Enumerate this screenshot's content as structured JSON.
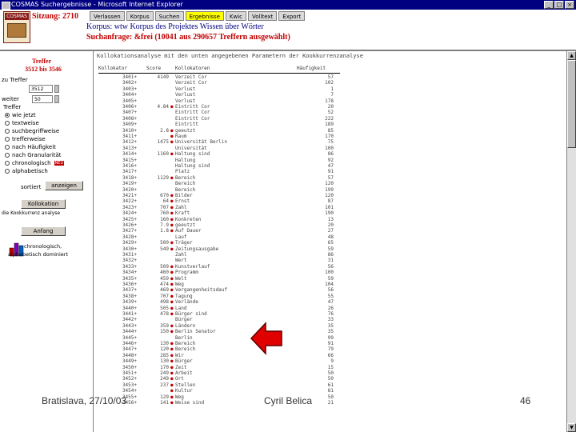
{
  "window": {
    "title": "COSMAS Suchergebnisse - Microsoft Internet Explorer"
  },
  "header": {
    "session": "Sitzung: 2710",
    "tabs": [
      "Verlassen",
      "Korpus",
      "Suchen",
      "Ergebnisse",
      "Kwic",
      "Volltext",
      "Export"
    ],
    "active_tab": "Ergebnisse",
    "korpus_line": "Korpus: wtw Korpus des Projektes Wissen über Wörter",
    "anfrage_line": "Suchanfrage: &frei (10041 aus 290657 Treffern ausgewählt)"
  },
  "sidebar": {
    "title": "Treffer",
    "range": "3512 bis 3546",
    "zu_treffer_label": "zu Treffer",
    "zu_treffer_value": "3512",
    "weiter_label": "weiter",
    "weiter_value": "50",
    "sort_label": "Treffer",
    "sort_options": [
      {
        "label": "wie jetzt",
        "checked": true
      },
      {
        "label": "textweise",
        "checked": false
      },
      {
        "label": "suchbegriffweise",
        "checked": false
      },
      {
        "label": "trefferweise",
        "checked": false
      },
      {
        "label": "nach Häufigkeit",
        "checked": false
      },
      {
        "label": "nach Granularität",
        "checked": false
      },
      {
        "label": "chronologisch",
        "checked": false,
        "badge": "NEU"
      },
      {
        "label": "alphabetisch",
        "checked": false
      }
    ],
    "sort_prefix": "sortiert",
    "anzeigen_button": "anzeigen",
    "kollokation_button": "Kollokation",
    "kollokation_hint": "die Kookkurrenz analyse",
    "anfang_button": "Anfang",
    "chrono_text_1": "chronologisch,",
    "chrono_text_2": "alphabetisch dominiert"
  },
  "content": {
    "info": "Kollokationsanalyse mit den unten angegebenen Parametern der Kookkurrenzanalyse",
    "columns": [
      "Kollokator",
      "Score",
      "Kollokatoren",
      "Häufigkeit"
    ],
    "rows": [
      {
        "rank": "3401+",
        "score": "4149",
        "mark": false,
        "word": "Verzeit Cor",
        "freq": "57"
      },
      {
        "rank": "3402+",
        "score": "",
        "mark": false,
        "word": "Verzeit Cor",
        "freq": "102"
      },
      {
        "rank": "3403+",
        "score": "",
        "mark": false,
        "word": "Verlust",
        "freq": "1"
      },
      {
        "rank": "3404+",
        "score": "",
        "mark": false,
        "word": "Verlust",
        "freq": "7"
      },
      {
        "rank": "3405+",
        "score": "",
        "mark": false,
        "word": "Verlust",
        "freq": "178"
      },
      {
        "rank": "3406+",
        "score": "4.84",
        "mark": true,
        "word": "Eintritt Cor",
        "freq": "20"
      },
      {
        "rank": "3407+",
        "score": "",
        "mark": false,
        "word": "Eintritt Cor",
        "freq": "52"
      },
      {
        "rank": "3408+",
        "score": "",
        "mark": false,
        "word": "Eintritt Cor",
        "freq": "222"
      },
      {
        "rank": "3409+",
        "score": "",
        "mark": false,
        "word": "Eintritt",
        "freq": "189"
      },
      {
        "rank": "3410+",
        "score": "2.8",
        "mark": true,
        "word": "geeutzt",
        "freq": "85"
      },
      {
        "rank": "3411+",
        "score": "",
        "mark": true,
        "word": "Raum",
        "freq": "170"
      },
      {
        "rank": "3412+",
        "score": "1475",
        "mark": true,
        "word": "Universität Berlin",
        "freq": "75"
      },
      {
        "rank": "3413+",
        "score": "",
        "mark": false,
        "word": "Universität",
        "freq": "100"
      },
      {
        "rank": "3414+",
        "score": "1160",
        "mark": true,
        "word": "Haltung sind",
        "freq": "86"
      },
      {
        "rank": "3415+",
        "score": "",
        "mark": false,
        "word": "Haltung",
        "freq": "92"
      },
      {
        "rank": "3416+",
        "score": "",
        "mark": false,
        "word": "Haltung sind",
        "freq": "47"
      },
      {
        "rank": "3417+",
        "score": "",
        "mark": false,
        "word": "Platz",
        "freq": "91"
      },
      {
        "rank": "3418+",
        "score": "1129",
        "mark": true,
        "word": "Bereich",
        "freq": "57"
      },
      {
        "rank": "3419+",
        "score": "",
        "mark": false,
        "word": "Bereich",
        "freq": "120"
      },
      {
        "rank": "3420+",
        "score": "",
        "mark": false,
        "word": "Bereich",
        "freq": "199"
      },
      {
        "rank": "3421+",
        "score": "670",
        "mark": true,
        "word": "Bilder",
        "freq": "120"
      },
      {
        "rank": "3422+",
        "score": "64",
        "mark": true,
        "word": "Ernst",
        "freq": "87"
      },
      {
        "rank": "3423+",
        "score": "707",
        "mark": true,
        "word": "Zahl",
        "freq": "101"
      },
      {
        "rank": "3424+",
        "score": "760",
        "mark": true,
        "word": "Kraft",
        "freq": "190"
      },
      {
        "rank": "3425+",
        "score": "160",
        "mark": true,
        "word": "Konkreten",
        "freq": "13"
      },
      {
        "rank": "3426+",
        "score": "7.9",
        "mark": true,
        "word": "geeutzt",
        "freq": "20"
      },
      {
        "rank": "3427+",
        "score": "1.8",
        "mark": true,
        "word": "Auf Dauer",
        "freq": "27"
      },
      {
        "rank": "3428+",
        "score": "",
        "mark": false,
        "word": "Lauf",
        "freq": "48"
      },
      {
        "rank": "3429+",
        "score": "500",
        "mark": true,
        "word": "Träger",
        "freq": "65"
      },
      {
        "rank": "3430+",
        "score": "549",
        "mark": true,
        "word": "Zeitungsausgabe",
        "freq": "59"
      },
      {
        "rank": "3431+",
        "score": "",
        "mark": false,
        "word": "Zahl",
        "freq": "86"
      },
      {
        "rank": "3432+",
        "score": "",
        "mark": false,
        "word": "Wert",
        "freq": "31"
      },
      {
        "rank": "3433+",
        "score": "509",
        "mark": true,
        "word": "Kunstverlauf",
        "freq": "56"
      },
      {
        "rank": "3434+",
        "score": "460",
        "mark": true,
        "word": "Programm",
        "freq": "100"
      },
      {
        "rank": "3435+",
        "score": "459",
        "mark": true,
        "word": "Welt",
        "freq": "59"
      },
      {
        "rank": "3436+",
        "score": "474",
        "mark": true,
        "word": "Weg",
        "freq": "104"
      },
      {
        "rank": "3437+",
        "score": "469",
        "mark": true,
        "word": "Vergangenheitsdauf",
        "freq": "56"
      },
      {
        "rank": "3438+",
        "score": "707",
        "mark": true,
        "word": "Tagung",
        "freq": "55"
      },
      {
        "rank": "3439+",
        "score": "498",
        "mark": true,
        "word": "Verlände",
        "freq": "47"
      },
      {
        "rank": "3440+",
        "score": "505",
        "mark": true,
        "word": "Land",
        "freq": "26"
      },
      {
        "rank": "3441+",
        "score": "478",
        "mark": true,
        "word": "Bürger sind",
        "freq": "76"
      },
      {
        "rank": "3442+",
        "score": "",
        "mark": false,
        "word": "Bürger",
        "freq": "33"
      },
      {
        "rank": "3443+",
        "score": "359",
        "mark": true,
        "word": "Ländern",
        "freq": "35"
      },
      {
        "rank": "3444+",
        "score": "150",
        "mark": true,
        "word": "Berlin Senator",
        "freq": "35"
      },
      {
        "rank": "3445+",
        "score": "",
        "mark": false,
        "word": "Berlin",
        "freq": "99"
      },
      {
        "rank": "3446+",
        "score": "130",
        "mark": true,
        "word": "Bereich",
        "freq": "91"
      },
      {
        "rank": "3447+",
        "score": "120",
        "mark": true,
        "word": "Bereich",
        "freq": "79"
      },
      {
        "rank": "3448+",
        "score": "285",
        "mark": true,
        "word": "Wir",
        "freq": "66"
      },
      {
        "rank": "3449+",
        "score": "130",
        "mark": true,
        "word": "Bürger",
        "freq": "9"
      },
      {
        "rank": "3450+",
        "score": "170",
        "mark": true,
        "word": "Zeit",
        "freq": "15"
      },
      {
        "rank": "3451+",
        "score": "249",
        "mark": true,
        "word": "Arbeit",
        "freq": "50"
      },
      {
        "rank": "3452+",
        "score": "249",
        "mark": true,
        "word": "Ort",
        "freq": "50"
      },
      {
        "rank": "3453+",
        "score": "237",
        "mark": true,
        "word": "Stellen",
        "freq": "61"
      },
      {
        "rank": "3454+",
        "score": "",
        "mark": true,
        "word": "Kultur",
        "freq": "81"
      },
      {
        "rank": "3455+",
        "score": "129",
        "mark": true,
        "word": "Weg",
        "freq": "50"
      },
      {
        "rank": "3456+",
        "score": "141",
        "mark": true,
        "word": "Weise sind",
        "freq": "21"
      }
    ]
  },
  "footer": {
    "left": "Bratislava, 27/10/03",
    "center": "Cyril Belica",
    "page": "46"
  },
  "colors": {
    "accent_red": "#c00000",
    "navy": "#000080",
    "arrow_red": "#e00000"
  }
}
